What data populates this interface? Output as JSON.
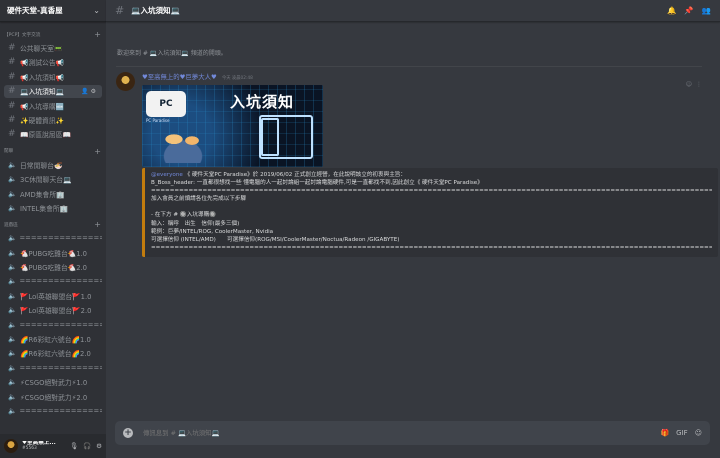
{
  "server": {
    "name": "硬件天堂-真香屋",
    "dropdown_icon": "chevron-down-icon"
  },
  "categories": [
    {
      "label": "【PCP】文字交流",
      "channels_key": "text"
    },
    {
      "label": "閒聊",
      "channels_key": "chat"
    },
    {
      "label": "遊戲區",
      "channels_key": "game"
    }
  ],
  "channels": {
    "text": [
      {
        "label": "公共聊天室📟",
        "type": "text",
        "active": false
      },
      {
        "label": "📢測試公告📢",
        "type": "text",
        "active": false
      },
      {
        "label": "📢入坑須知📢",
        "type": "text",
        "active": false
      },
      {
        "label": "💻入坑須知💻",
        "type": "text",
        "active": true
      },
      {
        "label": "📢入坑導購🆕",
        "type": "text",
        "active": false
      },
      {
        "label": "✨硬體資訊✨",
        "type": "text",
        "active": false
      },
      {
        "label": "📖原區說屈區📖",
        "type": "text",
        "active": false
      }
    ],
    "chat": [
      {
        "label": "日常閒聊台🍜",
        "type": "voice",
        "active": false
      },
      {
        "label": "3C休閒聊天台💻",
        "type": "voice",
        "active": false
      },
      {
        "label": "AMD集會所🏢",
        "type": "voice",
        "active": false
      },
      {
        "label": "INTEL集會所🏢",
        "type": "voice",
        "active": false
      }
    ],
    "game": [
      {
        "label": "=====================",
        "type": "voice",
        "active": false
      },
      {
        "label": "🐔PUBG吃雞台🐔1.0",
        "type": "voice",
        "active": false
      },
      {
        "label": "🐔PUBG吃雞台🐔2.0",
        "type": "voice",
        "active": false
      },
      {
        "label": "=====================",
        "type": "voice",
        "active": false
      },
      {
        "label": "🚩Lol英雄聯盟台🚩1.0",
        "type": "voice",
        "active": false
      },
      {
        "label": "🚩Lol英雄聯盟台🚩2.0",
        "type": "voice",
        "active": false
      },
      {
        "label": "=====================",
        "type": "voice",
        "active": false
      },
      {
        "label": "🌈R6彩虹六號台🌈1.0",
        "type": "voice",
        "active": false
      },
      {
        "label": "🌈R6彩虹六號台🌈2.0",
        "type": "voice",
        "active": false
      },
      {
        "label": "=====================",
        "type": "voice",
        "active": false
      },
      {
        "label": "⚡CSGO絕對武力⚡1.0",
        "type": "voice",
        "active": false
      },
      {
        "label": "⚡CSGO絕對武力⚡2.0",
        "type": "voice",
        "active": false
      },
      {
        "label": "=====================",
        "type": "voice",
        "active": false
      }
    ]
  },
  "user": {
    "name": "♥至高無上...",
    "tag": "#5563"
  },
  "channel_header": {
    "title": "💻入坑須知💻"
  },
  "welcome_text": "歡迎來到 # 💻入坑須知💻 頻道的開頭。",
  "message": {
    "author": "♥至高無上的♥巨夢大人♥",
    "timestamp": "今天 凌晨02:48",
    "banner_logo": "PC",
    "banner_sub": "PC Paradise",
    "banner_title": "入坑須知"
  },
  "embed_lines": [
    {
      "mention": "@everyone",
      "text": " 《 硬件天堂PC Paradise》於 2019/06/02 正式創立經營，在此說明該立的初衷與主旨："
    },
    {
      "mention": "",
      "text": "B_Boss_header: 一直都很想找一些 懂電腦的人一起討論組一起討論電腦硬件,可是一直都找不到,因此創立《 硬件天堂PC Paradise》"
    },
    {
      "mention": "",
      "text": "===================================================================================================================================="
    },
    {
      "mention": "",
      "text": "加入會員之前煩請各位先完成以下步驟"
    },
    {
      "mention": "",
      "text": ""
    },
    {
      "mention": "",
      "text": "- 在下方 # 🔘入坑導購🔘"
    },
    {
      "mention": "",
      "text": "輸入：稱呼　出生　信仰(最多三個)"
    },
    {
      "mention": "",
      "text": "範例：巨夢/INTEL/ROG, CoolerMaster, Nvidia"
    },
    {
      "mention": "",
      "text": "可選擇信仰 (INTEL/AMD)　　可選擇信仰(ROG/MSI/CoolerMaster/Noctua/Radeon /GIGABYTE)"
    },
    {
      "mention": "",
      "text": "==================================================================================================================================== (已編輯)"
    }
  ],
  "composer": {
    "placeholder": "傳訊息到 # 💻入坑須知💻"
  },
  "colors": {
    "accent": "#7289da",
    "embed_border": "#c27c0e",
    "sidebar": "#2f3136",
    "main": "#36393f"
  }
}
